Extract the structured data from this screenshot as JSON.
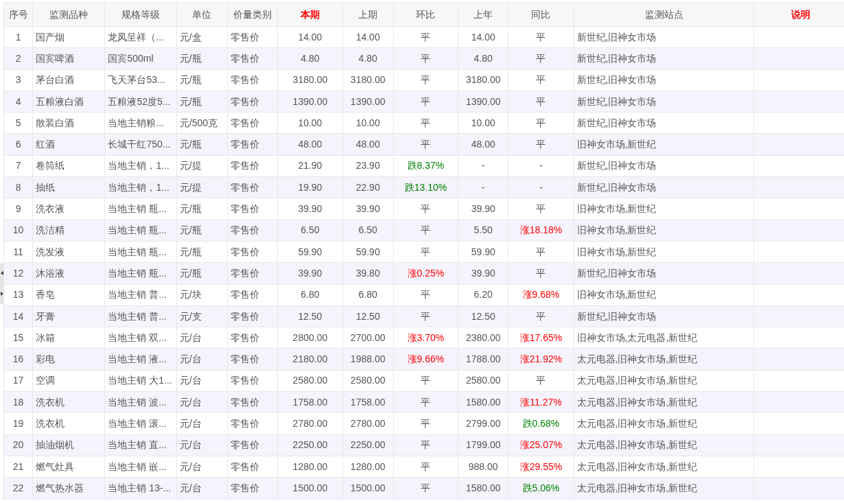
{
  "table": {
    "columns": [
      {
        "label": "序号",
        "highlight": false
      },
      {
        "label": "监测品种",
        "highlight": false
      },
      {
        "label": "规格等级",
        "highlight": false
      },
      {
        "label": "单位",
        "highlight": false
      },
      {
        "label": "价量类别",
        "highlight": false
      },
      {
        "label": "本期",
        "highlight": true
      },
      {
        "label": "上期",
        "highlight": false
      },
      {
        "label": "环比",
        "highlight": false
      },
      {
        "label": "上年",
        "highlight": false
      },
      {
        "label": "同比",
        "highlight": false
      },
      {
        "label": "监测站点",
        "highlight": false
      },
      {
        "label": "说明",
        "highlight": true
      }
    ],
    "rows": [
      {
        "no": "1",
        "item": "国产烟",
        "spec": "龙凤呈祥（...",
        "unit": "元/盒",
        "price_type": "零售价",
        "current": "14.00",
        "previous": "14.00",
        "mom": {
          "text": "平",
          "color": "#555555"
        },
        "last_year": "14.00",
        "yoy": {
          "text": "平",
          "color": "#555555"
        },
        "sites": "新世纪,旧神女市场"
      },
      {
        "no": "2",
        "item": "国宾啤酒",
        "spec": "国宾500ml",
        "unit": "元/瓶",
        "price_type": "零售价",
        "current": "4.80",
        "previous": "4.80",
        "mom": {
          "text": "平",
          "color": "#555555"
        },
        "last_year": "4.80",
        "yoy": {
          "text": "平",
          "color": "#555555"
        },
        "sites": "新世纪,旧神女市场"
      },
      {
        "no": "3",
        "item": "茅台白酒",
        "spec": "飞天茅台53...",
        "unit": "元/瓶",
        "price_type": "零售价",
        "current": "3180.00",
        "previous": "3180.00",
        "mom": {
          "text": "平",
          "color": "#555555"
        },
        "last_year": "3180.00",
        "yoy": {
          "text": "平",
          "color": "#555555"
        },
        "sites": "新世纪,旧神女市场"
      },
      {
        "no": "4",
        "item": "五粮液白酒",
        "spec": "五粮液52度5...",
        "unit": "元/瓶",
        "price_type": "零售价",
        "current": "1390.00",
        "previous": "1390.00",
        "mom": {
          "text": "平",
          "color": "#555555"
        },
        "last_year": "1390.00",
        "yoy": {
          "text": "平",
          "color": "#555555"
        },
        "sites": "新世纪,旧神女市场"
      },
      {
        "no": "5",
        "item": "散装白酒",
        "spec": "当地主销粮...",
        "unit": "元/500克",
        "price_type": "零售价",
        "current": "10.00",
        "previous": "10.00",
        "mom": {
          "text": "平",
          "color": "#555555"
        },
        "last_year": "10.00",
        "yoy": {
          "text": "平",
          "color": "#555555"
        },
        "sites": "新世纪,旧神女市场"
      },
      {
        "no": "6",
        "item": "红酒",
        "spec": "长城干红750...",
        "unit": "元/瓶",
        "price_type": "零售价",
        "current": "48.00",
        "previous": "48.00",
        "mom": {
          "text": "平",
          "color": "#555555"
        },
        "last_year": "48.00",
        "yoy": {
          "text": "平",
          "color": "#555555"
        },
        "sites": "旧神女市场,新世纪"
      },
      {
        "no": "7",
        "item": "卷筒纸",
        "spec": "当地主销，1...",
        "unit": "元/提",
        "price_type": "零售价",
        "current": "21.90",
        "previous": "23.90",
        "mom": {
          "text": "跌8.37%",
          "color": "#008000"
        },
        "last_year": "-",
        "yoy": {
          "text": "-",
          "color": "#555555"
        },
        "sites": "新世纪,旧神女市场"
      },
      {
        "no": "8",
        "item": "抽纸",
        "spec": "当地主销，1...",
        "unit": "元/提",
        "price_type": "零售价",
        "current": "19.90",
        "previous": "22.90",
        "mom": {
          "text": "跌13.10%",
          "color": "#008000"
        },
        "last_year": "-",
        "yoy": {
          "text": "-",
          "color": "#555555"
        },
        "sites": "新世纪,旧神女市场"
      },
      {
        "no": "9",
        "item": "洗衣液",
        "spec": "当地主销 瓶...",
        "unit": "元/瓶",
        "price_type": "零售价",
        "current": "39.90",
        "previous": "39.90",
        "mom": {
          "text": "平",
          "color": "#555555"
        },
        "last_year": "39.90",
        "yoy": {
          "text": "平",
          "color": "#555555"
        },
        "sites": "旧神女市场,新世纪"
      },
      {
        "no": "10",
        "item": "洗洁精",
        "spec": "当地主销 瓶...",
        "unit": "元/瓶",
        "price_type": "零售价",
        "current": "6.50",
        "previous": "6.50",
        "mom": {
          "text": "平",
          "color": "#555555"
        },
        "last_year": "5.50",
        "yoy": {
          "text": "涨18.18%",
          "color": "#ff0000"
        },
        "sites": "旧神女市场,新世纪"
      },
      {
        "no": "11",
        "item": "洗发液",
        "spec": "当地主销 瓶...",
        "unit": "元/瓶",
        "price_type": "零售价",
        "current": "59.90",
        "previous": "59.90",
        "mom": {
          "text": "平",
          "color": "#555555"
        },
        "last_year": "59.90",
        "yoy": {
          "text": "平",
          "color": "#555555"
        },
        "sites": "旧神女市场,新世纪"
      },
      {
        "no": "12",
        "item": "沐浴液",
        "spec": "当地主销 瓶...",
        "unit": "元/瓶",
        "price_type": "零售价",
        "current": "39.90",
        "previous": "39.80",
        "mom": {
          "text": "涨0.25%",
          "color": "#ff0000"
        },
        "last_year": "39.90",
        "yoy": {
          "text": "平",
          "color": "#555555"
        },
        "sites": "新世纪,旧神女市场"
      },
      {
        "no": "13",
        "item": "香皂",
        "spec": "当地主销 普...",
        "unit": "元/块",
        "price_type": "零售价",
        "current": "6.80",
        "previous": "6.80",
        "mom": {
          "text": "平",
          "color": "#555555"
        },
        "last_year": "6.20",
        "yoy": {
          "text": "涨9.68%",
          "color": "#ff0000"
        },
        "sites": "旧神女市场,新世纪"
      },
      {
        "no": "14",
        "item": "牙膏",
        "spec": "当地主销 普...",
        "unit": "元/支",
        "price_type": "零售价",
        "current": "12.50",
        "previous": "12.50",
        "mom": {
          "text": "平",
          "color": "#555555"
        },
        "last_year": "12.50",
        "yoy": {
          "text": "平",
          "color": "#555555"
        },
        "sites": "新世纪,旧神女市场"
      },
      {
        "no": "15",
        "item": "冰箱",
        "spec": "当地主销 双...",
        "unit": "元/台",
        "price_type": "零售价",
        "current": "2800.00",
        "previous": "2700.00",
        "mom": {
          "text": "涨3.70%",
          "color": "#ff0000"
        },
        "last_year": "2380.00",
        "yoy": {
          "text": "涨17.65%",
          "color": "#ff0000"
        },
        "sites": "旧神女市场,太元电器,新世纪"
      },
      {
        "no": "16",
        "item": "彩电",
        "spec": "当地主销 液...",
        "unit": "元/台",
        "price_type": "零售价",
        "current": "2180.00",
        "previous": "1988.00",
        "mom": {
          "text": "涨9.66%",
          "color": "#ff0000"
        },
        "last_year": "1788.00",
        "yoy": {
          "text": "涨21.92%",
          "color": "#ff0000"
        },
        "sites": "太元电器,旧神女市场,新世纪"
      },
      {
        "no": "17",
        "item": "空调",
        "spec": "当地主销 大1...",
        "unit": "元/台",
        "price_type": "零售价",
        "current": "2580.00",
        "previous": "2580.00",
        "mom": {
          "text": "平",
          "color": "#555555"
        },
        "last_year": "2580.00",
        "yoy": {
          "text": "平",
          "color": "#555555"
        },
        "sites": "太元电器,旧神女市场,新世纪"
      },
      {
        "no": "18",
        "item": "洗衣机",
        "spec": "当地主销 波...",
        "unit": "元/台",
        "price_type": "零售价",
        "current": "1758.00",
        "previous": "1758.00",
        "mom": {
          "text": "平",
          "color": "#555555"
        },
        "last_year": "1580.00",
        "yoy": {
          "text": "涨11.27%",
          "color": "#ff0000"
        },
        "sites": "太元电器,旧神女市场,新世纪"
      },
      {
        "no": "19",
        "item": "洗衣机",
        "spec": "当地主销 滚...",
        "unit": "元/台",
        "price_type": "零售价",
        "current": "2780.00",
        "previous": "2780.00",
        "mom": {
          "text": "平",
          "color": "#555555"
        },
        "last_year": "2799.00",
        "yoy": {
          "text": "跌0.68%",
          "color": "#008000"
        },
        "sites": "太元电器,旧神女市场,新世纪"
      },
      {
        "no": "20",
        "item": "抽油烟机",
        "spec": "当地主销 直...",
        "unit": "元/台",
        "price_type": "零售价",
        "current": "2250.00",
        "previous": "2250.00",
        "mom": {
          "text": "平",
          "color": "#555555"
        },
        "last_year": "1799.00",
        "yoy": {
          "text": "涨25.07%",
          "color": "#ff0000"
        },
        "sites": "太元电器,旧神女市场,新世纪"
      },
      {
        "no": "21",
        "item": "燃气灶具",
        "spec": "当地主销 嵌...",
        "unit": "元/台",
        "price_type": "零售价",
        "current": "1280.00",
        "previous": "1280.00",
        "mom": {
          "text": "平",
          "color": "#555555"
        },
        "last_year": "988.00",
        "yoy": {
          "text": "涨29.55%",
          "color": "#ff0000"
        },
        "sites": "太元电器,旧神女市场,新世纪"
      },
      {
        "no": "22",
        "item": "燃气热水器",
        "spec": "当地主销 13-...",
        "unit": "元/台",
        "price_type": "零售价",
        "current": "1500.00",
        "previous": "1500.00",
        "mom": {
          "text": "平",
          "color": "#555555"
        },
        "last_year": "1580.00",
        "yoy": {
          "text": "跌5.06%",
          "color": "#008000"
        },
        "sites": "太元电器,旧神女市场,新世纪"
      }
    ]
  }
}
